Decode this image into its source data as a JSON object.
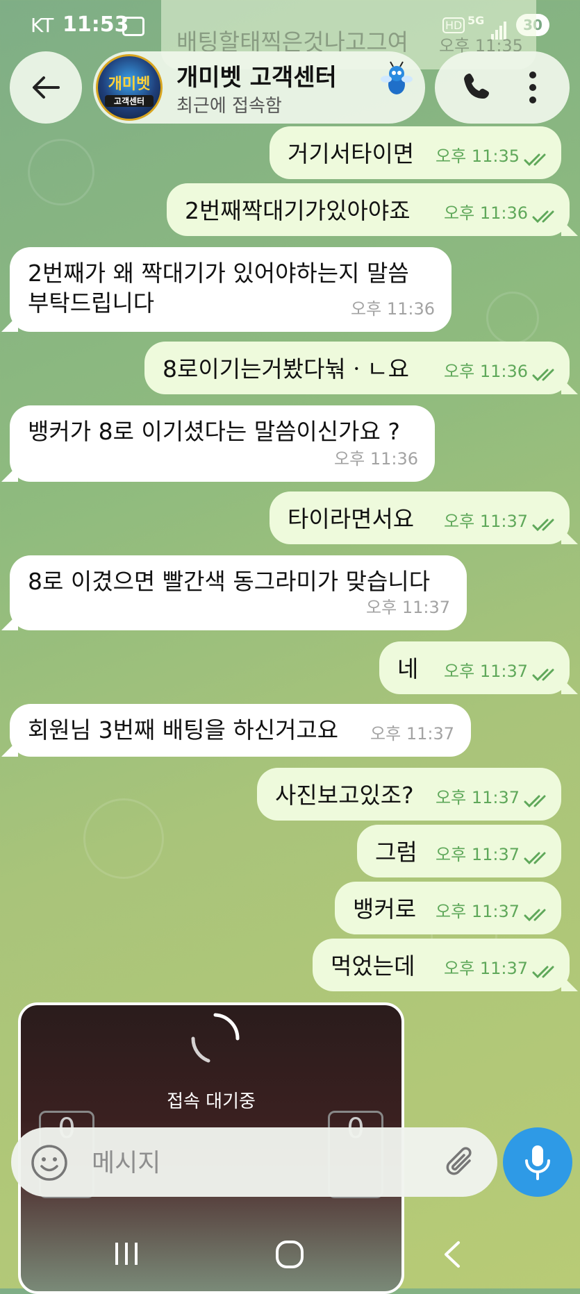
{
  "status_bar": {
    "carrier": "KT",
    "time": "11:53",
    "hd": "HD",
    "network": "5G",
    "battery": "30"
  },
  "previous_message_peek": {
    "text": "배팅할태찍은것나고그여",
    "time": "오후 11:35"
  },
  "header": {
    "title": "개미벳 고객센터",
    "status": "최근에 접속함",
    "avatar_title": "개미벳",
    "avatar_sub": "고객센터",
    "back_icon": "arrow-left-icon",
    "call_icon": "phone-icon",
    "menu_icon": "more-vertical-icon"
  },
  "colors": {
    "outgoing_bubble": "#eefadc",
    "incoming_bubble": "#ffffff",
    "read_ticks": "#5fa85a",
    "mic_button": "#2e9ae6"
  },
  "messages": [
    {
      "dir": "out",
      "text": "거기서타이면",
      "time": "오후 11:35",
      "read": true
    },
    {
      "dir": "out",
      "text": "2번째짝대기가있아야죠",
      "time": "오후 11:36",
      "read": true
    },
    {
      "dir": "in",
      "text": "2번째가 왜 짝대기가 있어야하는지 말씀\n부탁드립니다",
      "time": "오후 11:36"
    },
    {
      "dir": "out",
      "text": "8로이기는거봤다눢ㆍㄴ요",
      "time": "오후 11:36",
      "read": true
    },
    {
      "dir": "in",
      "text": "뱅커가 8로 이기셨다는 말씀이신가요 ?",
      "time": "오후 11:36"
    },
    {
      "dir": "out",
      "text": "타이라면서요",
      "time": "오후 11:37",
      "read": true
    },
    {
      "dir": "in",
      "text": "8로 이겼으면 빨간색 동그라미가 맞습니다",
      "time": "오후 11:37"
    },
    {
      "dir": "out",
      "text": "네",
      "time": "오후 11:37",
      "read": true
    },
    {
      "dir": "in",
      "text": "회원님 3번째 배팅을 하신거고요",
      "time": "오후 11:37"
    },
    {
      "dir": "out",
      "text": "사진보고있조?",
      "time": "오후 11:37",
      "read": true
    },
    {
      "dir": "out",
      "text": "그럼",
      "time": "오후 11:37",
      "read": true
    },
    {
      "dir": "out",
      "text": "뱅커로",
      "time": "오후 11:37",
      "read": true
    },
    {
      "dir": "out",
      "text": "먹었는데",
      "time": "오후 11:37",
      "read": true
    }
  ],
  "media": {
    "loading_text": "접속 대기중",
    "score_left": "0",
    "score_right": "0"
  },
  "input": {
    "placeholder": "메시지",
    "emoji_icon": "emoji-icon",
    "attach_icon": "paperclip-icon",
    "mic_icon": "microphone-icon"
  },
  "nav": {
    "recents_icon": "recents-icon",
    "home_icon": "home-icon",
    "back_icon": "back-chevron-icon"
  }
}
